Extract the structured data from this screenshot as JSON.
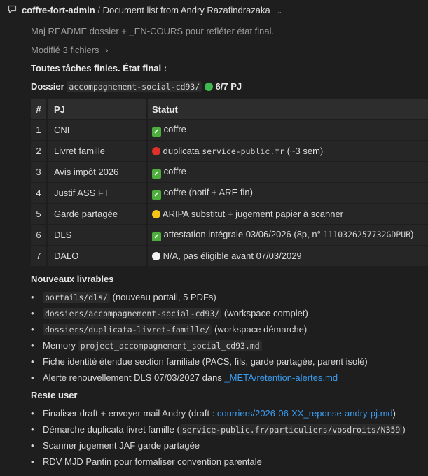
{
  "header": {
    "workspace": "coffre-fort-admin",
    "separator": "/",
    "title": "Document list from Andry Razafindrazaka",
    "icon": "chat-bubble-icon"
  },
  "commit": {
    "message": "Maj README dossier + _EN-COURS pour refléter état final.",
    "files_changed": "Modifié 3 fichiers",
    "chevron": "›"
  },
  "summary": {
    "heading": "Toutes tâches finies. État final :",
    "dossier_label": "Dossier",
    "dossier_path": "accompagnement-social-cd93/",
    "status_color": "#3fb950",
    "count": "6/7 PJ"
  },
  "table": {
    "headers": [
      "#",
      "PJ",
      "Statut"
    ],
    "rows": [
      {
        "num": "1",
        "pj": "CNI",
        "status_icon": "check",
        "status_text": "coffre",
        "code": "",
        "suffix": ""
      },
      {
        "num": "2",
        "pj": "Livret famille",
        "status_icon": "red",
        "status_text": "duplicata ",
        "code": "service-public.fr",
        "suffix": " (~3 sem)"
      },
      {
        "num": "3",
        "pj": "Avis impôt 2026",
        "status_icon": "check",
        "status_text": "coffre",
        "code": "",
        "suffix": ""
      },
      {
        "num": "4",
        "pj": "Justif ASS FT",
        "status_icon": "check",
        "status_text": "coffre (notif + ARE fin)",
        "code": "",
        "suffix": ""
      },
      {
        "num": "5",
        "pj": "Garde partagée",
        "status_icon": "yellow",
        "status_text": "ARIPA substitut + jugement papier à scanner",
        "code": "",
        "suffix": ""
      },
      {
        "num": "6",
        "pj": "DLS",
        "status_icon": "check",
        "status_text": "attestation intégrale 03/06/2026 (8p, n° ",
        "code": "1110326257732GDPUB",
        "suffix": ")"
      },
      {
        "num": "7",
        "pj": "DALO",
        "status_icon": "white",
        "status_text": "N/A, pas éligible avant 07/03/2029",
        "code": "",
        "suffix": ""
      }
    ]
  },
  "livrables": {
    "heading": "Nouveaux livrables",
    "items": [
      {
        "code": "portails/dls/",
        "text": " (nouveau portail, 5 PDFs)"
      },
      {
        "code": "dossiers/accompagnement-social-cd93/",
        "text": " (workspace complet)"
      },
      {
        "code": "dossiers/duplicata-livret-famille/",
        "text": " (workspace démarche)"
      },
      {
        "prefix": "Memory ",
        "code": "project_accompagnement_social_cd93.md",
        "text": ""
      },
      {
        "prefix": "Fiche identité étendue section familiale (PACS, fils, garde partagée, parent isolé)",
        "code": "",
        "text": ""
      },
      {
        "prefix": "Alerte renouvellement DLS 07/03/2027 dans ",
        "link": "_META/retention-alertes.md"
      }
    ]
  },
  "reste": {
    "heading": "Reste user",
    "items": [
      {
        "prefix": "Finaliser draft + envoyer mail Andry (draft : ",
        "link": "courriers/2026-06-XX_reponse-andry-pj.md",
        "suffix": ")"
      },
      {
        "prefix": "Démarche duplicata livret famille (",
        "code": "service-public.fr/particuliers/vosdroits/N359",
        "suffix": ")"
      },
      {
        "prefix": "Scanner jugement JAF garde partagée"
      },
      {
        "prefix": "RDV MJD Pantin pour formaliser convention parentale"
      }
    ]
  },
  "colors": {
    "red": "#e0302b",
    "yellow": "#f5c518",
    "white": "#f2f2f2",
    "check": "#4caf3c",
    "link": "#3b9cf0"
  }
}
